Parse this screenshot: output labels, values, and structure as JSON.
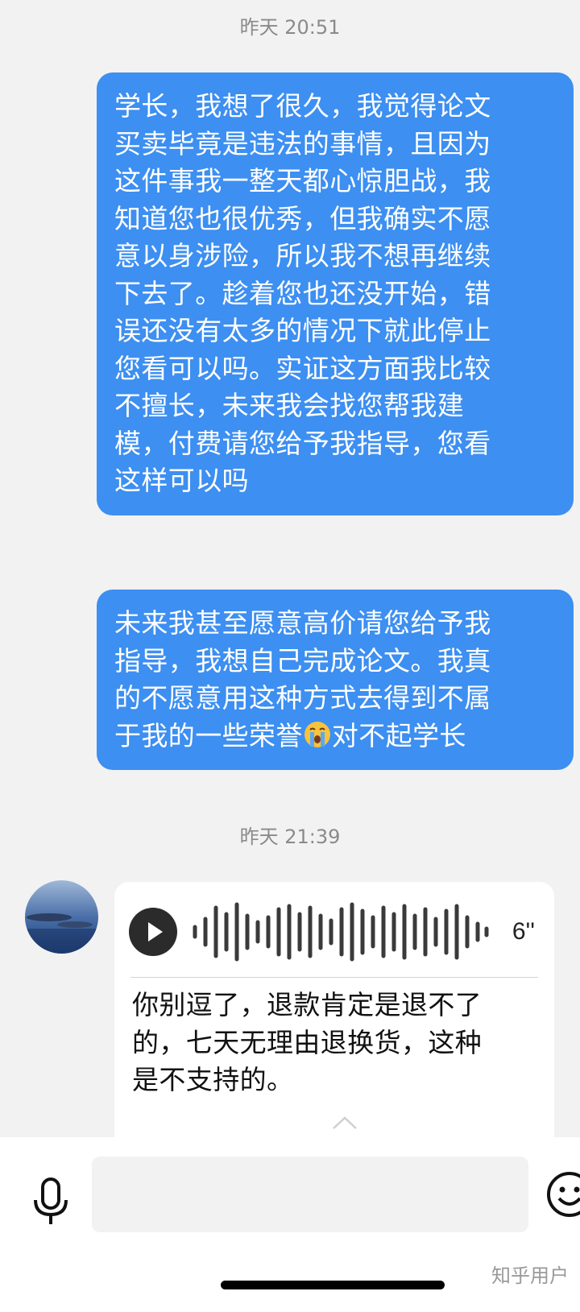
{
  "conversation": {
    "timestamp_1": "昨天 20:51",
    "outgoing_1": {
      "lines": [
        "学长，我想了很久，我觉得论文",
        "买卖毕竟是违法的事情，且因为",
        "这件事我一整天都心惊胆战，我",
        "知道您也很优秀，但我确实不愿",
        "意以身涉险，所以我不想再继续",
        "下去了。趁着您也还没开始，错",
        "误还没有太多的情况下就此停止",
        "您看可以吗。实证这方面我比较",
        "不擅长，未来我会找您帮我建",
        "模，付费请您给予我指导，您看",
        "这样可以吗"
      ]
    },
    "outgoing_2": {
      "lines": [
        "未来我甚至愿意高价请您给予我",
        "指导，我想自己完成论文。我真",
        "的不愿意用这种方式去得到不属"
      ],
      "last_line_before_emoji": "于我的一些荣誉",
      "emoji_icon": "loudly-crying-face",
      "last_line_after_emoji": "对不起学长"
    },
    "timestamp_2": "昨天 21:39",
    "incoming_voice": {
      "duration": "6''",
      "transcript_lines": [
        "你别逗了，退款肯定是退不了",
        "的，七天无理由退换货，这种",
        "是不支持的。"
      ]
    }
  },
  "input_bar": {
    "placeholder": "",
    "left_icon": "microphone",
    "right_icon": "emoji-face"
  },
  "watermark": "知乎用户",
  "colors": {
    "background": "#f2f2f2",
    "outgoing_bubble": "#3d8ff1",
    "incoming_bubble": "#ffffff"
  }
}
